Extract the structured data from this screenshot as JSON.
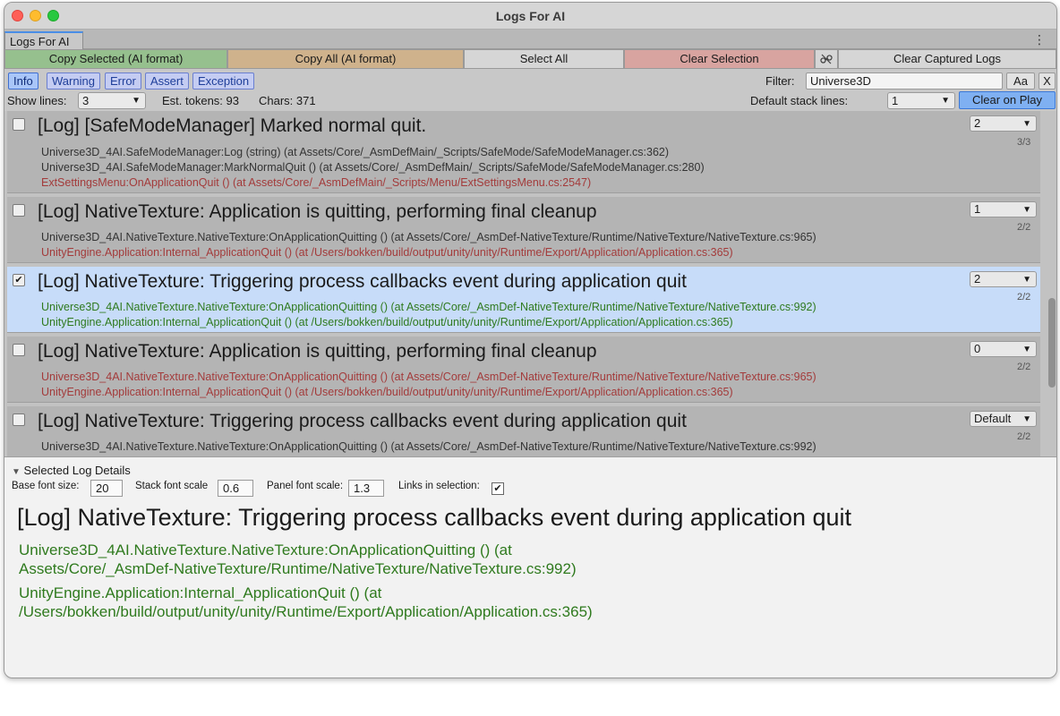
{
  "window": {
    "title": "Logs For AI",
    "tab_label": "Logs For AI",
    "menu_icon": "kebab-menu-icon"
  },
  "toolbar": {
    "copy_selected": "Copy Selected (AI format)",
    "copy_all": "Copy All (AI format)",
    "select_all": "Select All",
    "clear_selection": "Clear Selection",
    "link_icon": "link-off-icon",
    "clear_captured": "Clear Captured Logs"
  },
  "filters": {
    "types": [
      "Info",
      "Warning",
      "Error",
      "Assert",
      "Exception"
    ],
    "filter_label": "Filter:",
    "filter_value": "Universe3D",
    "case_button": "Aa",
    "clear_button": "X"
  },
  "options": {
    "show_lines_label": "Show lines:",
    "show_lines_value": "3",
    "est_tokens": "Est. tokens: 93",
    "chars": "Chars: 371",
    "default_stack_label": "Default stack lines:",
    "default_stack_value": "1",
    "clear_on_play": "Clear on Play"
  },
  "logs": [
    {
      "message": "[Log] [SafeModeManager] Marked normal quit.",
      "checked": false,
      "selected": false,
      "lines": "2",
      "count": "3/3",
      "stack": [
        {
          "text": "Universe3D_4AI.SafeModeManager:Log (string) (at Assets/Core/_AsmDefMain/_Scripts/SafeMode/SafeModeManager.cs:362)",
          "color": "gray"
        },
        {
          "text": "Universe3D_4AI.SafeModeManager:MarkNormalQuit () (at Assets/Core/_AsmDefMain/_Scripts/SafeMode/SafeModeManager.cs:280)",
          "color": "gray"
        },
        {
          "text": "ExtSettingsMenu:OnApplicationQuit () (at Assets/Core/_AsmDefMain/_Scripts/Menu/ExtSettingsMenu.cs:2547)",
          "color": "red"
        }
      ]
    },
    {
      "message": "[Log] NativeTexture: Application is quitting, performing final cleanup",
      "checked": false,
      "selected": false,
      "lines": "1",
      "count": "2/2",
      "stack": [
        {
          "text": "Universe3D_4AI.NativeTexture.NativeTexture:OnApplicationQuitting () (at Assets/Core/_AsmDef-NativeTexture/Runtime/NativeTexture/NativeTexture.cs:965)",
          "color": "gray"
        },
        {
          "text": "UnityEngine.Application:Internal_ApplicationQuit () (at /Users/bokken/build/output/unity/unity/Runtime/Export/Application/Application.cs:365)",
          "color": "red"
        }
      ]
    },
    {
      "message": "[Log] NativeTexture: Triggering process callbacks event during application quit",
      "checked": true,
      "selected": true,
      "lines": "2",
      "count": "2/2",
      "stack": [
        {
          "text": "Universe3D_4AI.NativeTexture.NativeTexture:OnApplicationQuitting () (at Assets/Core/_AsmDef-NativeTexture/Runtime/NativeTexture/NativeTexture.cs:992)",
          "color": "green"
        },
        {
          "text": "UnityEngine.Application:Internal_ApplicationQuit () (at /Users/bokken/build/output/unity/unity/Runtime/Export/Application/Application.cs:365)",
          "color": "green"
        }
      ]
    },
    {
      "message": "[Log] NativeTexture: Application is quitting, performing final cleanup",
      "checked": false,
      "selected": false,
      "lines": "0",
      "count": "2/2",
      "stack": [
        {
          "text": "Universe3D_4AI.NativeTexture.NativeTexture:OnApplicationQuitting () (at Assets/Core/_AsmDef-NativeTexture/Runtime/NativeTexture/NativeTexture.cs:965)",
          "color": "red"
        },
        {
          "text": "UnityEngine.Application:Internal_ApplicationQuit () (at /Users/bokken/build/output/unity/unity/Runtime/Export/Application/Application.cs:365)",
          "color": "red"
        }
      ]
    },
    {
      "message": "[Log] NativeTexture: Triggering process callbacks event during application quit",
      "checked": false,
      "selected": false,
      "lines": "Default",
      "count": "2/2",
      "stack": [
        {
          "text": "Universe3D_4AI.NativeTexture.NativeTexture:OnApplicationQuitting () (at Assets/Core/_AsmDef-NativeTexture/Runtime/NativeTexture/NativeTexture.cs:992)",
          "color": "gray"
        }
      ]
    }
  ],
  "details": {
    "header": "Selected Log Details",
    "base_font_label": "Base font size:",
    "base_font_value": "20",
    "stack_scale_label": "Stack font scale",
    "stack_scale_value": "0.6",
    "panel_scale_label": "Panel font scale:",
    "panel_scale_value": "1.3",
    "links_label": "Links in selection:",
    "links_checked": true,
    "title": "[Log] NativeTexture: Triggering process callbacks event during application quit",
    "stack": [
      [
        "Universe3D_4AI.NativeTexture.NativeTexture:OnApplicationQuitting () (at",
        "Assets/Core/_AsmDef-NativeTexture/Runtime/NativeTexture/NativeTexture.cs:992)"
      ],
      [
        "UnityEngine.Application:Internal_ApplicationQuit () (at",
        "/Users/bokken/build/output/unity/unity/Runtime/Export/Application/Application.cs:365)"
      ]
    ]
  }
}
